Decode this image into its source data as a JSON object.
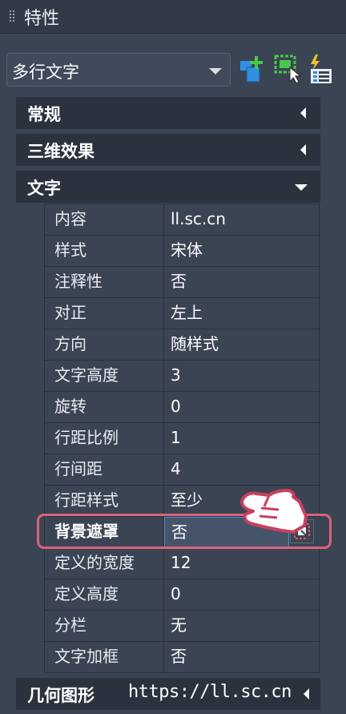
{
  "window": {
    "title": "特性"
  },
  "selector": {
    "value": "多行文字"
  },
  "toolbar": {
    "quick_select_icon": "quick-select-add-icon",
    "select_objects_icon": "select-objects-icon",
    "toggle_pickadd_icon": "toggle-pickadd-icon"
  },
  "sections": {
    "general": {
      "label": "常规",
      "state": "collapsed"
    },
    "3d_effects": {
      "label": "三维效果",
      "state": "collapsed"
    },
    "text": {
      "label": "文字",
      "state": "expanded"
    },
    "geometry": {
      "label": "几何图形",
      "state": "collapsed"
    }
  },
  "properties": [
    {
      "name": "内容",
      "value": "ll.sc.cn"
    },
    {
      "name": "样式",
      "value": "宋体"
    },
    {
      "name": "注释性",
      "value": "否"
    },
    {
      "name": "对正",
      "value": "左上"
    },
    {
      "name": "方向",
      "value": "随样式"
    },
    {
      "name": "文字高度",
      "value": "3"
    },
    {
      "name": "旋转",
      "value": "0"
    },
    {
      "name": "行距比例",
      "value": "1"
    },
    {
      "name": "行间距",
      "value": "4"
    },
    {
      "name": "行距样式",
      "value": "至少"
    },
    {
      "name": "背景遮罩",
      "value": "否"
    },
    {
      "name": "定义的宽度",
      "value": "12"
    },
    {
      "name": "定义高度",
      "value": "0"
    },
    {
      "name": "分栏",
      "value": "无"
    },
    {
      "name": "文字加框",
      "value": "否"
    }
  ],
  "selected_property_index": 10,
  "watermark": {
    "url": "https://ll.sc.cn"
  },
  "colors": {
    "background": "#3b4453",
    "section_header": "#2b323e",
    "highlight_outline": "#d9637a",
    "selection_border": "#4f8fd6",
    "icon_blue": "#2f8fe0",
    "icon_green": "#47c84a"
  }
}
